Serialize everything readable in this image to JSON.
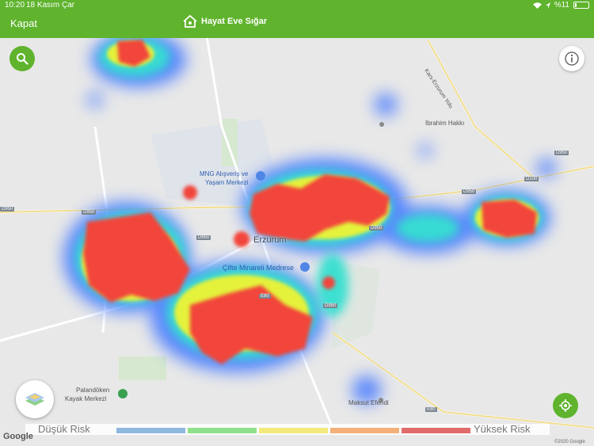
{
  "status": {
    "time": "10:20",
    "date": "18 Kasım Çar",
    "battery": "%11"
  },
  "header": {
    "close_label": "Kapat",
    "app_title": "Hayat Eve Sığar"
  },
  "map": {
    "city_label": "Erzurum",
    "places": {
      "mall_1": "MNG Alışveriş ve",
      "mall_2": "Yaşam Merkezi",
      "madrasa": "Çifte Minareli Medrese",
      "ski_1": "Palandöken",
      "ski_2": "Kayak Merkezi",
      "ibrahim": "İbrahim Hakkı",
      "maksut": "Maksut Efendi",
      "kars_road": "Kars-Erzurum Yolu"
    },
    "road_tags": {
      "d950": "D950",
      "d100": "D100",
      "e80": "E80"
    }
  },
  "legend": {
    "low_label": "Düşük Risk",
    "high_label": "Yüksek Risk",
    "colors": [
      "#8fb8df",
      "#8fe08a",
      "#f3ea7e",
      "#f3b07a",
      "#e06b6b"
    ]
  },
  "footer": {
    "google": "Google",
    "copyright": "©2020 Google"
  }
}
